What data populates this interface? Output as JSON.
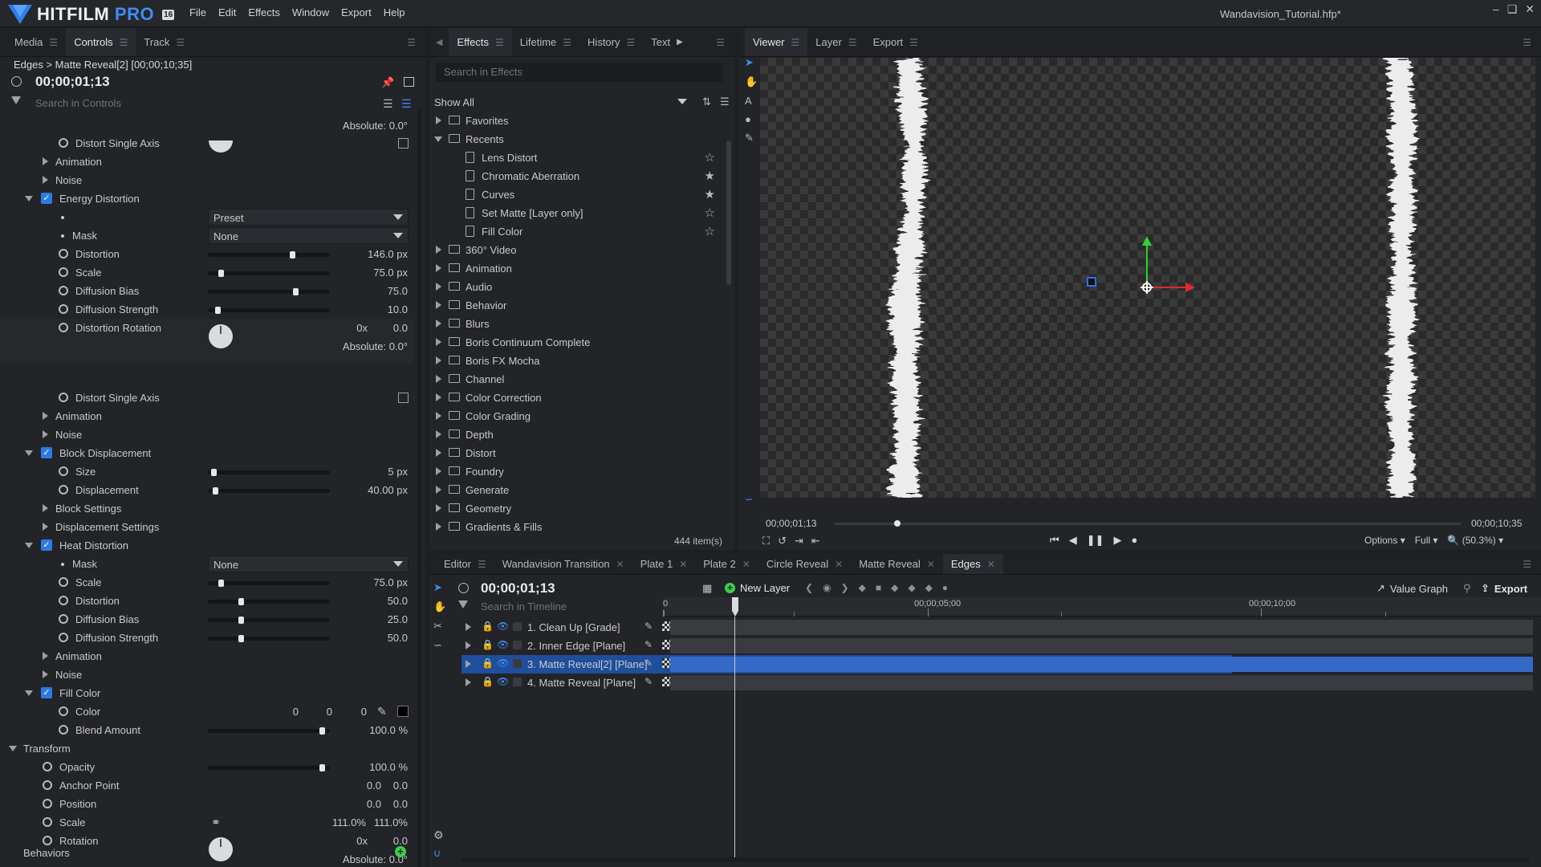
{
  "app": {
    "name": "HITFILM",
    "name_pro": "PRO",
    "version": "16",
    "menu": [
      "File",
      "Edit",
      "Effects",
      "Window",
      "Export",
      "Help"
    ],
    "window_title": "Wandavision_Tutorial.hfp*"
  },
  "left_panel": {
    "tabs": [
      "Media",
      "Controls",
      "Track"
    ],
    "breadcrumb": "Edges > Matte Reveal[2] [00;00;10;35]",
    "timecode": "00;00;01;13",
    "search_placeholder": "Search in Controls",
    "top_absolute": "Absolute: 0.0°",
    "rows": {
      "distort_single_axis_1": "Distort Single Axis",
      "animation_1": "Animation",
      "noise_1": "Noise",
      "energy_distortion": "Energy Distortion",
      "preset_label": "Preset",
      "mask_1": "Mask",
      "mask_1_value": "None",
      "distortion_1": "Distortion",
      "distortion_1_value": "146.0 px",
      "scale_1": "Scale",
      "scale_1_value": "75.0 px",
      "diffusion_bias_1": "Diffusion Bias",
      "diffusion_bias_1_value": "75.0",
      "diffusion_strength_1": "Diffusion Strength",
      "diffusion_strength_1_value": "10.0",
      "distortion_rotation": "Distortion Rotation",
      "distortion_rotation_x": "0x",
      "distortion_rotation_value": "0.0",
      "distortion_rotation_abs": "Absolute: 0.0°",
      "distort_single_axis_2": "Distort Single Axis",
      "animation_2": "Animation",
      "noise_2": "Noise",
      "block_displacement": "Block Displacement",
      "size": "Size",
      "size_value": "5 px",
      "displacement": "Displacement",
      "displacement_value": "40.00 px",
      "block_settings": "Block Settings",
      "displacement_settings": "Displacement Settings",
      "heat_distortion": "Heat Distortion",
      "mask_2": "Mask",
      "mask_2_value": "None",
      "scale_2": "Scale",
      "scale_2_value": "75.0 px",
      "distortion_2": "Distortion",
      "distortion_2_value": "50.0",
      "diffusion_bias_2": "Diffusion Bias",
      "diffusion_bias_2_value": "25.0",
      "diffusion_strength_2": "Diffusion Strength",
      "diffusion_strength_2_value": "50.0",
      "animation_3": "Animation",
      "noise_3": "Noise",
      "fill_color": "Fill Color",
      "color": "Color",
      "color_r": "0",
      "color_g": "0",
      "color_b": "0",
      "blend_amount": "Blend Amount",
      "blend_amount_value": "100.0 %",
      "transform": "Transform",
      "opacity": "Opacity",
      "opacity_value": "100.0 %",
      "anchor_point": "Anchor Point",
      "anchor_x": "0.0",
      "anchor_y": "0.0",
      "position": "Position",
      "position_x": "0.0",
      "position_y": "0.0",
      "scale_t": "Scale",
      "scale_t_x": "111.0%",
      "scale_t_y": "111.0%",
      "rotation": "Rotation",
      "rotation_x": "0x",
      "rotation_value": "0.0",
      "rotation_abs": "Absolute: 0.0°",
      "behaviors": "Behaviors"
    },
    "slider_levels": {
      "distortion_1": 0.7,
      "scale_1": 0.09,
      "diffusion_bias_1": 0.73,
      "diffusion_strength_1": 0.06,
      "size": 0.03,
      "displacement": 0.04,
      "scale_2": 0.09,
      "distortion_2": 0.26,
      "diffusion_bias_2": 0.26,
      "diffusion_strength_2": 0.26,
      "blend_amount": 0.96,
      "opacity": 0.96
    }
  },
  "effects_panel": {
    "tabs": [
      "Effects",
      "Lifetime",
      "History",
      "Text"
    ],
    "search_placeholder": "Search in Effects",
    "filter": "Show All",
    "folders_top": [
      "Favorites",
      "Recents"
    ],
    "recents": [
      "Lens Distort",
      "Chromatic Aberration",
      "Curves",
      "Set Matte [Layer only]",
      "Fill Color"
    ],
    "recent_starred": [
      false,
      true,
      true,
      false,
      false
    ],
    "folders": [
      "360° Video",
      "Animation",
      "Audio",
      "Behavior",
      "Blurs",
      "Boris Continuum Complete",
      "Boris FX Mocha",
      "Channel",
      "Color Correction",
      "Color Grading",
      "Depth",
      "Distort",
      "Foundry",
      "Generate",
      "Geometry",
      "Gradients & Fills"
    ],
    "item_count": "444 item(s)"
  },
  "viewer_panel": {
    "tabs": [
      "Viewer",
      "Layer",
      "Export"
    ],
    "current_time": "00;00;01;13",
    "end_time": "00;00;10;35",
    "options_label": "Options",
    "quality_label": "Full",
    "zoom_label": "(50.3%)",
    "playhead_fraction": 0.1
  },
  "timeline_panel": {
    "tabs": [
      "Editor",
      "Wandavision Transition",
      "Plate 1",
      "Plate 2",
      "Circle Reveal",
      "Matte Reveal",
      "Edges"
    ],
    "timecode": "00;00;01;13",
    "new_layer_label": "New Layer",
    "value_graph_label": "Value Graph",
    "export_label": "Export",
    "search_placeholder": "Search in Timeline",
    "ruler": [
      "0",
      "00;00;05;00",
      "00;00;10;00"
    ],
    "layers": [
      {
        "name": "1. Clean Up [Grade]",
        "blend": "None"
      },
      {
        "name": "2. Inner Edge [Plane]",
        "blend": "None"
      },
      {
        "name": "3. Matte Reveal[2] [Plane]",
        "blend": "None"
      },
      {
        "name": "4. Matte Reveal [Plane]",
        "blend": "None"
      }
    ],
    "selected_layer_index": 2
  },
  "colors": {
    "accent": "#2c7be5",
    "selected_row": "#1f4e9b",
    "panel_bg": "#232428",
    "add_green": "#3ccf4e"
  }
}
